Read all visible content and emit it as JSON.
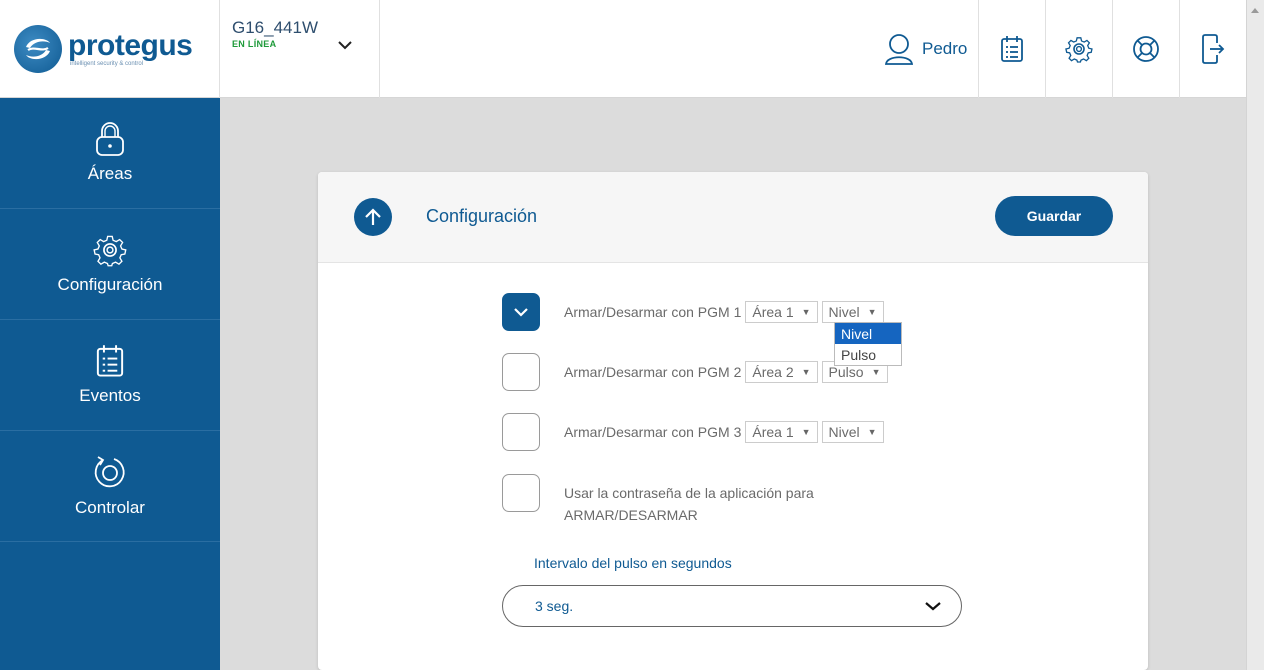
{
  "header": {
    "logo_word": "protegus",
    "logo_tagline": "intelligent security & control",
    "device_name": "G16_441W",
    "device_status": "EN LÍNEA",
    "user_name": "Pedro"
  },
  "sidebar": {
    "items": [
      {
        "label": "Áreas",
        "icon": "lock-icon"
      },
      {
        "label": "Configuración",
        "icon": "gear-icon"
      },
      {
        "label": "Eventos",
        "icon": "calendar-list-icon"
      },
      {
        "label": "Controlar",
        "icon": "rotate-icon"
      }
    ]
  },
  "card": {
    "title": "Configuración",
    "save_label": "Guardar",
    "rows": [
      {
        "label": "Armar/Desarmar con PGM 1",
        "area": "Área 1",
        "mode": "Nivel",
        "checked": true
      },
      {
        "label": "Armar/Desarmar con PGM 2",
        "area": "Área 2",
        "mode": "Pulso",
        "checked": false
      },
      {
        "label": "Armar/Desarmar con PGM 3",
        "area": "Área 1",
        "mode": "Nivel",
        "checked": false
      }
    ],
    "app_password_label": "Usar la contraseña de la aplicación para ARMAR/DESARMAR",
    "mode_options": [
      "Nivel",
      "Pulso"
    ],
    "interval_label": "Intervalo del pulso en segundos",
    "interval_value": "3 seg."
  },
  "colors": {
    "brand": "#0f5a92",
    "online": "#1e9a3a",
    "background": "#dcdcdc"
  }
}
